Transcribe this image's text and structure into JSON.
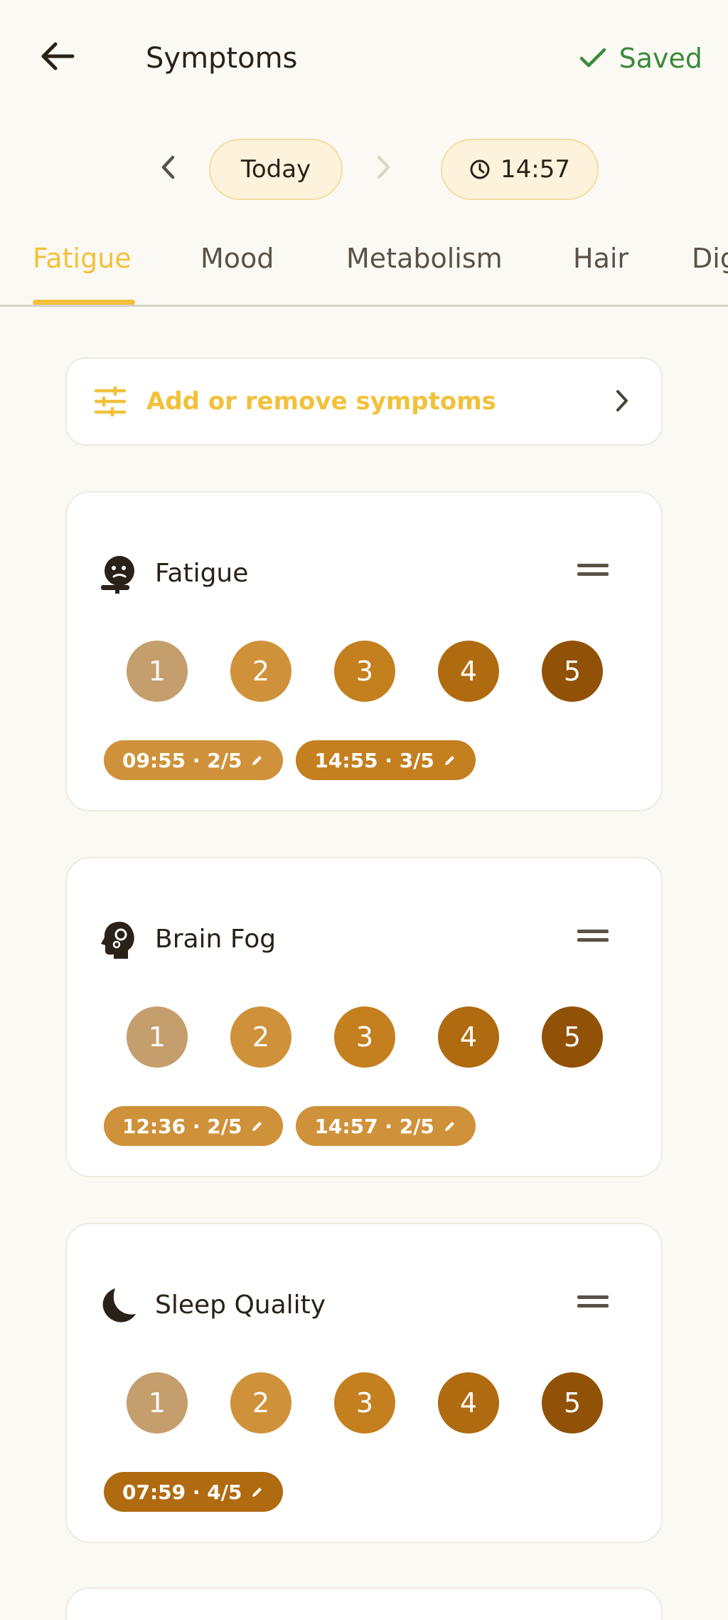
{
  "header": {
    "title": "Symptoms",
    "saved_label": "Saved",
    "back_icon": "arrow-left-icon",
    "saved_icon": "check-icon"
  },
  "date": {
    "day_label": "Today",
    "time_label": "14:57"
  },
  "tabs": [
    {
      "label": "Fatigue",
      "active": true
    },
    {
      "label": "Mood",
      "active": false
    },
    {
      "label": "Metabolism",
      "active": false
    },
    {
      "label": "Hair",
      "active": false
    },
    {
      "label": "Dig",
      "active": false
    }
  ],
  "manage": {
    "label": "Add or remove symptoms",
    "icon": "sliders-icon"
  },
  "scale_levels": [
    "1",
    "2",
    "3",
    "4",
    "5"
  ],
  "colors": {
    "accent": "#f2c13a",
    "saved_green": "#3a8a3a",
    "level_1": "#c49e6c",
    "level_2": "#cf923a",
    "level_3": "#c47f1f",
    "level_4": "#b06a10",
    "level_5": "#915208"
  },
  "symptoms": [
    {
      "name": "Fatigue",
      "icon": "tired-face-icon",
      "entries": [
        {
          "label": "09:55 · 2/5",
          "level": 2
        },
        {
          "label": "14:55 · 3/5",
          "level": 3
        }
      ]
    },
    {
      "name": "Brain Fog",
      "icon": "head-gears-icon",
      "entries": [
        {
          "label": "12:36 · 2/5",
          "level": 2
        },
        {
          "label": "14:57 · 2/5",
          "level": 2
        }
      ]
    },
    {
      "name": "Sleep Quality",
      "icon": "moon-icon",
      "entries": [
        {
          "label": "07:59 · 4/5",
          "level": 4
        }
      ]
    }
  ]
}
